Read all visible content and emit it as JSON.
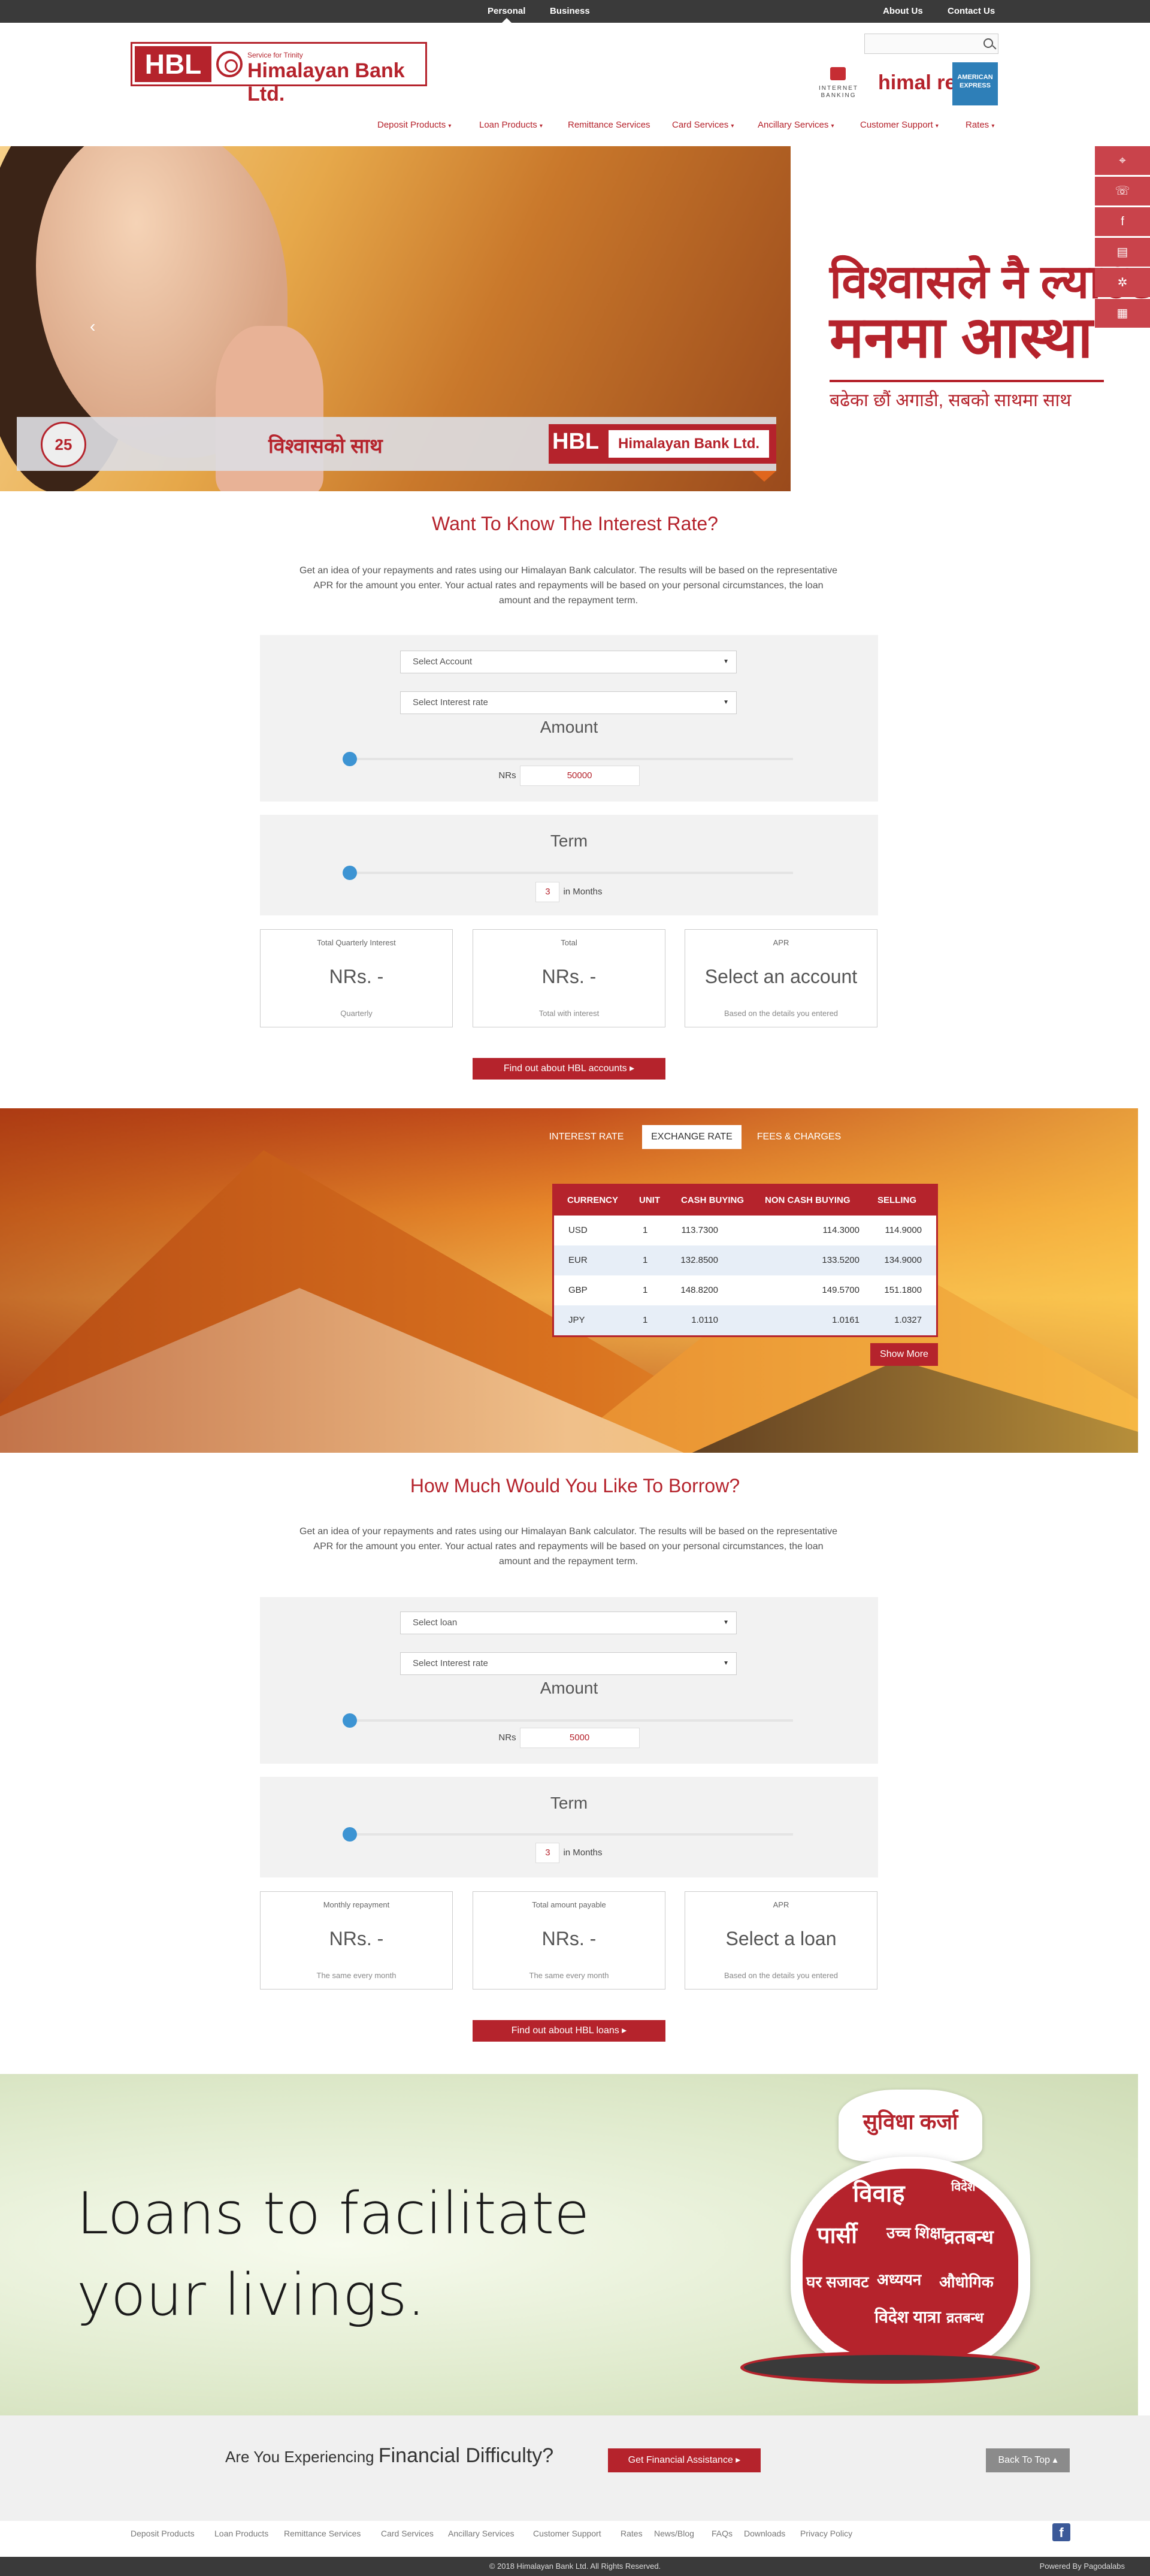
{
  "topbar": {
    "segments": [
      "Personal",
      "Business"
    ],
    "links": [
      "About Us",
      "Contact Us"
    ]
  },
  "brand": {
    "short": "HBL",
    "tagline": "Service for Trinity",
    "name": "Himalayan Bank Ltd."
  },
  "search": {
    "placeholder": ""
  },
  "partners": [
    "INTERNET BANKING",
    "himal remit",
    "AMERICAN EXPRESS"
  ],
  "nav": [
    {
      "label": "Deposit Products",
      "dropdown": true
    },
    {
      "label": "Loan Products",
      "dropdown": true
    },
    {
      "label": "Remittance Services",
      "dropdown": false
    },
    {
      "label": "Card Services",
      "dropdown": true
    },
    {
      "label": "Ancillary Services",
      "dropdown": true
    },
    {
      "label": "Customer Support",
      "dropdown": true
    },
    {
      "label": "Rates",
      "dropdown": true
    }
  ],
  "hero": {
    "badge": "25",
    "trust_text": "विश्वासको साथ",
    "logo_short": "HBL",
    "logo_name": "Himalayan Bank Ltd.",
    "headline_1": "विश्वासले नै ल्याउँछ",
    "headline_2": "मनमा आस्था",
    "headline_3": "बढेका छौं अगाडी, सबको साथमा साथ"
  },
  "side_rail": [
    "location-icon",
    "phone-icon",
    "facebook-icon",
    "document-icon",
    "settings-icon",
    "form-icon"
  ],
  "interest": {
    "title": "Want To Know The Interest Rate?",
    "intro": "Get an idea of your repayments and rates using our Himalayan Bank calculator. The results will be based on the representative APR for the amount you enter. Your actual rates and repayments will be based on your personal circumstances, the loan amount and the repayment term.",
    "select_account": "Select Account",
    "select_rate": "Select Interest rate",
    "amount_label": "Amount",
    "currency": "NRs",
    "amount_value": "50000",
    "term_label": "Term",
    "term_value": "3",
    "term_unit": "in Months",
    "cards": [
      {
        "title": "Total Quarterly Interest",
        "value": "NRs. -",
        "sub": "Quarterly"
      },
      {
        "title": "Total",
        "value": "NRs. -",
        "sub": "Total with interest"
      },
      {
        "title": "APR",
        "value": "Select an account",
        "sub": "Based on the details you entered"
      }
    ],
    "cta": "Find out about HBL accounts ▸"
  },
  "rates": {
    "tabs": [
      "INTEREST RATE",
      "EXCHANGE RATE",
      "FEES & CHARGES"
    ],
    "active_tab": "EXCHANGE RATE",
    "headers": [
      "CURRENCY",
      "UNIT",
      "CASH BUYING",
      "NON CASH BUYING",
      "SELLING"
    ],
    "rows": [
      [
        "USD",
        "1",
        "113.7300",
        "114.3000",
        "114.9000"
      ],
      [
        "EUR",
        "1",
        "132.8500",
        "133.5200",
        "134.9000"
      ],
      [
        "GBP",
        "1",
        "148.8200",
        "149.5700",
        "151.1800"
      ],
      [
        "JPY",
        "1",
        "1.0110",
        "1.0161",
        "1.0327"
      ]
    ],
    "show_more": "Show More"
  },
  "borrow": {
    "title": "How Much Would You Like To Borrow?",
    "intro": "Get an idea of your repayments and rates using our Himalayan Bank calculator. The results will be based on the representative APR for the amount you enter. Your actual rates and repayments will be based on your personal circumstances, the loan amount and the repayment term.",
    "select_loan": "Select loan",
    "select_rate": "Select Interest rate",
    "amount_label": "Amount",
    "currency": "NRs",
    "amount_value": "5000",
    "term_label": "Term",
    "term_value": "3",
    "term_unit": "in Months",
    "cards": [
      {
        "title": "Monthly repayment",
        "value": "NRs. -",
        "sub": "The same every month"
      },
      {
        "title": "Total amount payable",
        "value": "NRs. -",
        "sub": "The same every month"
      },
      {
        "title": "APR",
        "value": "Select a loan",
        "sub": "Based on the details you entered"
      }
    ],
    "cta": "Find out about HBL loans ▸"
  },
  "loans_banner": {
    "line1": "Loans to facilitate",
    "line2": "your livings.",
    "bag_title": "सुविधा कर्जा",
    "bag_words": [
      "विवाह",
      "विदेश यात्रा",
      "पार्सी",
      "उच्च शिक्षा",
      "व्रतबन्ध",
      "घर सजावट",
      "अध्ययन",
      "औधोगिक",
      "विदेश यात्रा",
      "व्रतबन्ध"
    ]
  },
  "difficulty": {
    "question_small": "Are You Experiencing",
    "question_big": "Financial Difficulty?",
    "assist_button": "Get Financial Assistance ▸",
    "top_button": "Back To Top ▴"
  },
  "footer": {
    "links": [
      "Deposit Products",
      "Loan Products",
      "Remittance Services",
      "Card Services",
      "Ancillary Services",
      "Customer Support",
      "Rates",
      "News/Blog",
      "FAQs",
      "Downloads",
      "Privacy Policy"
    ],
    "copyright": "© 2018 Himalayan Bank Ltd. All Rights Reserved.",
    "powered": "Powered By Pagodalabs"
  },
  "colors": {
    "brand": "#b5232c",
    "slider": "#3d94d3",
    "topbar": "#3a3a3a"
  }
}
